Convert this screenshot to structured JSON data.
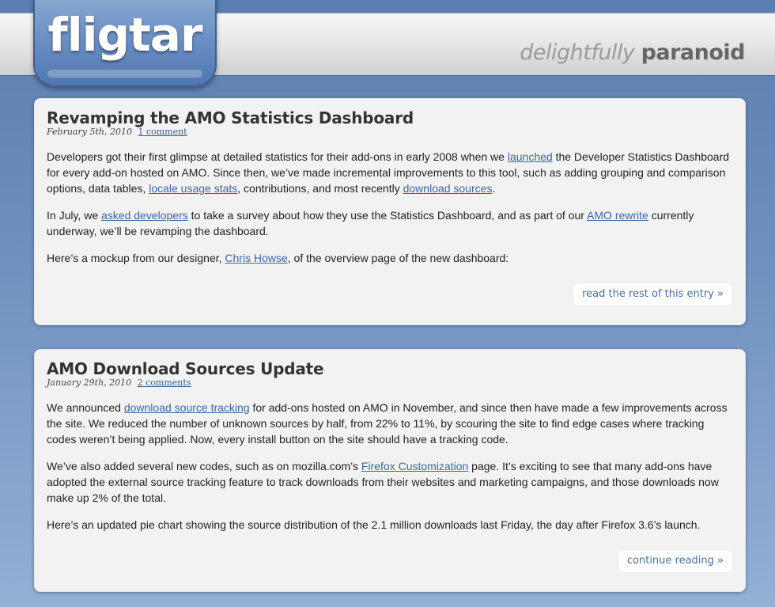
{
  "site": {
    "logo": "fligtar",
    "tagline_light": "delightfully",
    "tagline_bold": "paranoid"
  },
  "posts": [
    {
      "title": "Revamping the AMO Statistics Dashboard",
      "date": "February 5th, 2010",
      "comments": "1 comment",
      "p1": {
        "t1": "Developers got their first glimpse at detailed statistics for their add-ons in early 2008 when we ",
        "l1": "launched",
        "t2": " the Developer Statistics Dashboard for every add-on hosted on AMO. Since then, we’ve made incremental improvements to this tool, such as adding grouping and comparison options, data tables, ",
        "l2": "locale usage stats",
        "t3": ", contributions, and most recently ",
        "l3": "download sources",
        "t4": "."
      },
      "p2": {
        "t1": "In July, we ",
        "l1": "asked developers",
        "t2": " to take a survey about how they use the Statistics Dashboard, and as part of our ",
        "l2": "AMO rewrite",
        "t3": " currently underway, we’ll be revamping the dashboard."
      },
      "p3": {
        "t1": "Here’s a mockup from our designer, ",
        "l1": "Chris Howse",
        "t2": ", of the overview page of the new dashboard:"
      },
      "read_more": "read the rest of this entry »"
    },
    {
      "title": "AMO Download Sources Update",
      "date": "January 29th, 2010",
      "comments": "2 comments",
      "p1": {
        "t1": "We announced ",
        "l1": "download source tracking",
        "t2": " for add-ons hosted on AMO in November, and since then have made a few improvements across the site. We reduced the number of unknown sources by half, from 22% to 11%, by scouring the site to find edge cases where tracking codes weren’t being applied. Now, every install button on the site should have a tracking code."
      },
      "p2": {
        "t1": "We’ve also added several new codes, such as on mozilla.com’s ",
        "l1": "Firefox Customization",
        "t2": " page. It’s exciting to see that many add-ons have adopted the external source tracking feature to track downloads from their websites and marketing campaigns, and those downloads now make up 2% of the total."
      },
      "p3": {
        "t1": "Here’s an updated pie chart showing the source distribution of the 2.1 million downloads last Friday, the day after Firefox 3.6’s launch."
      },
      "read_more": "continue reading »"
    }
  ]
}
